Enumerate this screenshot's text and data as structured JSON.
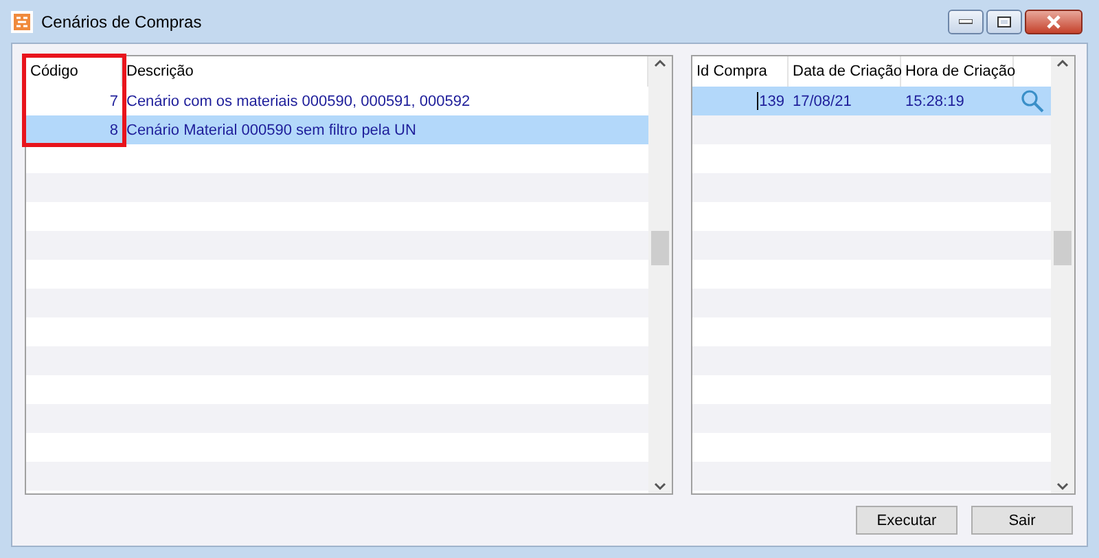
{
  "window": {
    "title": "Cenários de Compras"
  },
  "scenarios": {
    "columns": [
      {
        "label": "Código",
        "highlighted": true
      },
      {
        "label": "Descrição",
        "highlighted": false
      }
    ],
    "rows": [
      {
        "code": "7",
        "description": "Cenário com os materiais 000590, 000591, 000592",
        "selected": false
      },
      {
        "code": "8",
        "description": "Cenário Material 000590 sem filtro pela UN",
        "selected": true
      }
    ]
  },
  "purchases": {
    "columns": [
      "Id Compra",
      "Data de Criação",
      "Hora de Criação"
    ],
    "rows": [
      {
        "id": "139",
        "date": "17/08/21",
        "time": "15:28:19",
        "selected": true
      }
    ]
  },
  "buttons": [
    {
      "label": "Executar"
    },
    {
      "label": "Sair"
    }
  ]
}
